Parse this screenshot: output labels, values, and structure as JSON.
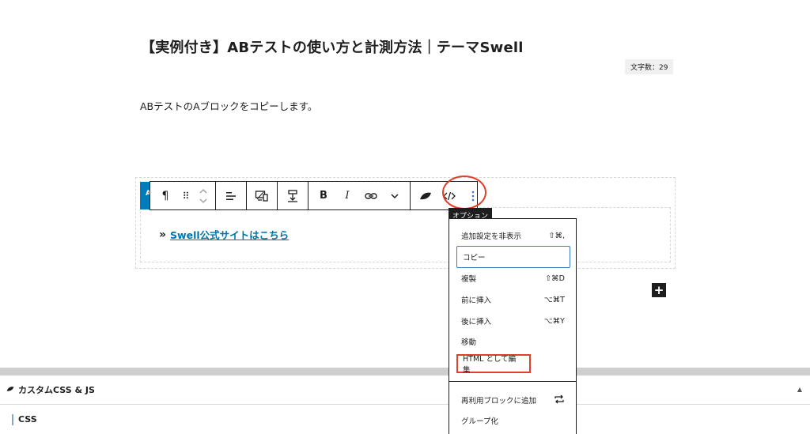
{
  "post": {
    "title": "【実例付き】ABテストの使い方と計測方法｜テーマSwell",
    "word_count": "文字数：29",
    "paragraph": "ABテストのAブロックをコピーします。"
  },
  "block": {
    "tab_letter": "A",
    "link_chevron": "»",
    "link_text": "Swell公式サイトはこちら",
    "add_symbol": "+"
  },
  "toolbar": {
    "paragraph_symbol": "¶",
    "drag_symbol": "⠿",
    "bold_label": "B",
    "italic_label": "I",
    "tooltip": "オプション",
    "icons": [
      "paragraph-icon",
      "drag-handle-icon",
      "move-up-down-icon",
      "align-icon",
      "swell-device-icon",
      "swell-margin-icon",
      "bold-icon",
      "italic-icon",
      "link-icon",
      "chevron-down-icon",
      "swell-leaf-icon",
      "code-icon",
      "more-options-icon"
    ]
  },
  "menu": {
    "items": [
      {
        "label": "追加設定を非表示",
        "shortcut": "⇧⌘,"
      },
      {
        "label": "コピー",
        "shortcut": ""
      },
      {
        "label": "複製",
        "shortcut": "⇧⌘D"
      },
      {
        "label": "前に挿入",
        "shortcut": "⌥⌘T"
      },
      {
        "label": "後に挿入",
        "shortcut": "⌥⌘Y"
      },
      {
        "label": "移動",
        "shortcut": ""
      },
      {
        "label": "HTML として編集",
        "shortcut": ""
      },
      {
        "label": "再利用ブロックに追加",
        "shortcut": ""
      },
      {
        "label": "グループ化",
        "shortcut": ""
      }
    ]
  },
  "panel": {
    "title": "カスタムCSS & JS",
    "css_label": "CSS",
    "caret": "▲"
  },
  "colors": {
    "accent": "#007cba",
    "link": "#0073aa",
    "annotation_red": "#e0402a",
    "focus_blue": "#3a7bc8"
  }
}
